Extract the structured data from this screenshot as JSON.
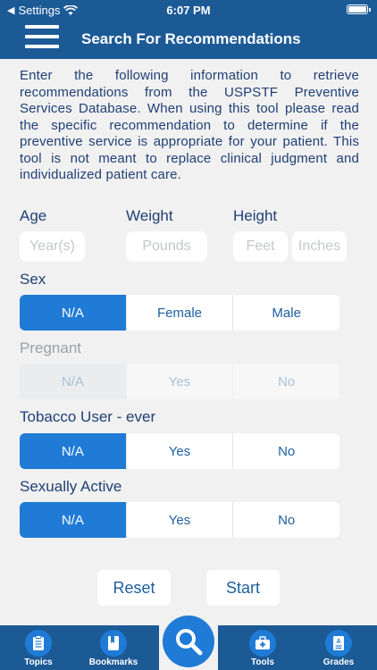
{
  "status": {
    "carrier": "Settings",
    "time": "6:07 PM"
  },
  "header": {
    "title": "Search For Recommendations"
  },
  "intro": "Enter the following information to retrieve recommendations from the USPSTF Preventive Services Database. When using this tool please read the specific recommendation to determine if the preventive service is appropriate for your patient. This tool is not meant to replace clinical judgment and individualized patient care.",
  "fields": {
    "age": {
      "label": "Age",
      "placeholder": "Year(s)"
    },
    "weight": {
      "label": "Weight",
      "placeholder": "Pounds"
    },
    "height": {
      "label": "Height",
      "feet_placeholder": "Feet",
      "inches_placeholder": "Inches"
    }
  },
  "sex": {
    "label": "Sex",
    "options": [
      "N/A",
      "Female",
      "Male"
    ],
    "selected": "N/A"
  },
  "pregnant": {
    "label": "Pregnant",
    "options": [
      "N/A",
      "Yes",
      "No"
    ],
    "selected": "N/A",
    "disabled": true
  },
  "tobacco": {
    "label": "Tobacco User - ever",
    "options": [
      "N/A",
      "Yes",
      "No"
    ],
    "selected": "N/A"
  },
  "sexually_active": {
    "label": "Sexually Active",
    "options": [
      "N/A",
      "Yes",
      "No"
    ],
    "selected": "N/A"
  },
  "buttons": {
    "reset": "Reset",
    "start": "Start"
  },
  "tabbar": {
    "topics": "Topics",
    "bookmarks": "Bookmarks",
    "tools": "Tools",
    "grades": "Grades"
  },
  "colors": {
    "header": "#1c5a96",
    "accent": "#1f7bd6",
    "text": "#1f3f73"
  }
}
